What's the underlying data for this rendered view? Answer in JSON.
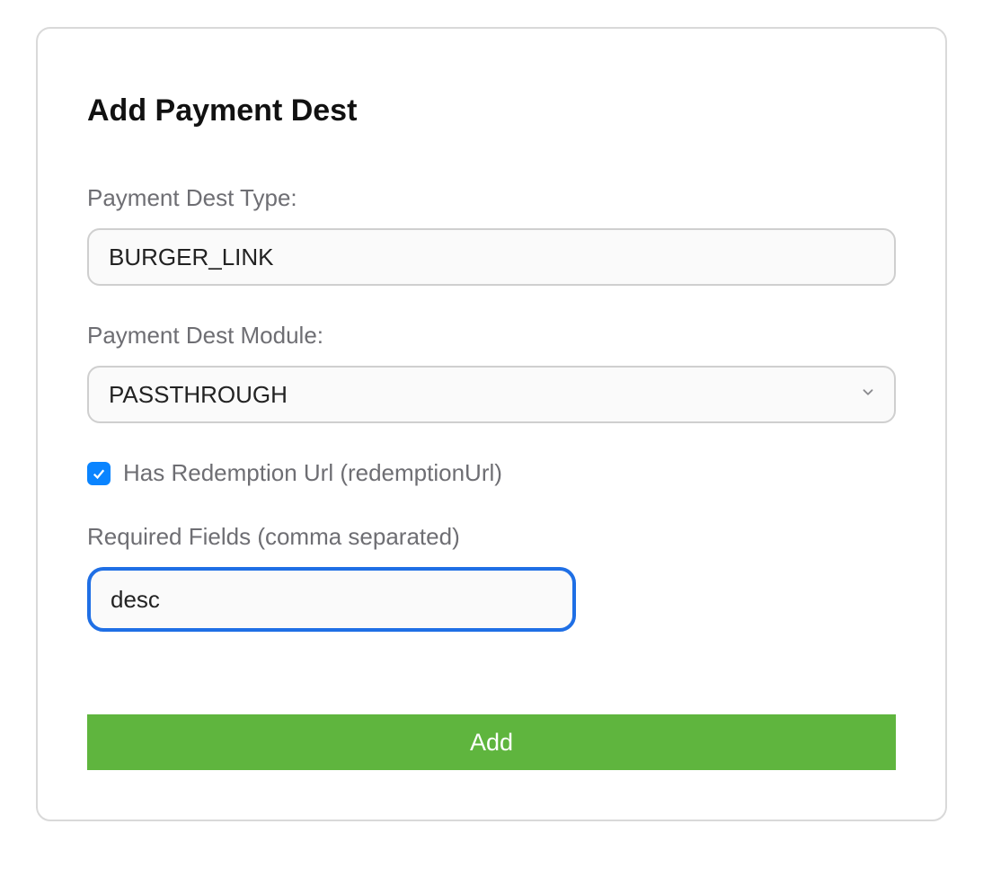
{
  "card": {
    "title": "Add Payment Dest",
    "fields": {
      "payment_dest_type": {
        "label": "Payment Dest Type:",
        "value": "BURGER_LINK"
      },
      "payment_dest_module": {
        "label": "Payment Dest Module:",
        "value": "PASSTHROUGH"
      },
      "has_redemption_url": {
        "label": "Has Redemption Url (redemptionUrl)",
        "checked": true
      },
      "required_fields": {
        "label": "Required Fields (comma separated)",
        "value": "desc"
      }
    },
    "button": {
      "add_label": "Add"
    }
  },
  "colors": {
    "accent_blue": "#0a84ff",
    "focus_blue": "#1f6fe5",
    "button_green": "#5fb53e",
    "label_gray": "#6e6e73",
    "border_gray": "#cfcfcf"
  }
}
